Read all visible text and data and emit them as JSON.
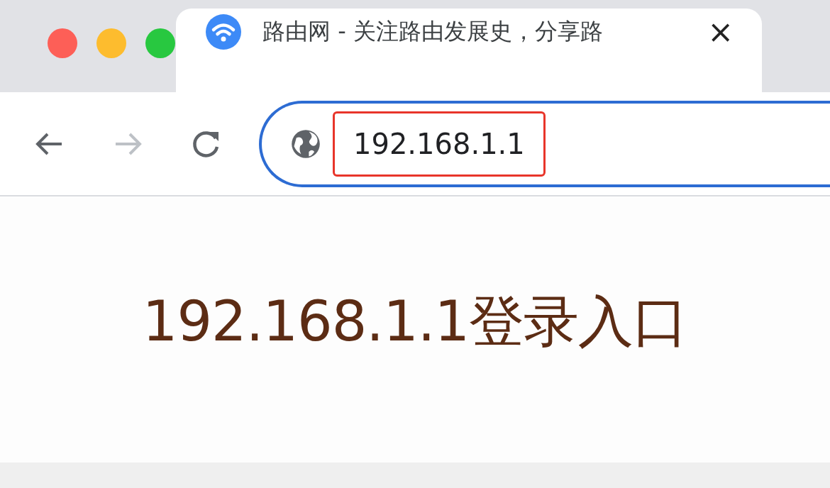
{
  "tab": {
    "title": "路由网 - 关注路由发展史，分享路",
    "selected": true,
    "close": "×"
  },
  "toolbar": {
    "buttons": [
      {
        "kind": "back",
        "disabled": false
      },
      {
        "kind": "forward",
        "disabled": true
      },
      {
        "kind": "reload",
        "disabled": false
      }
    ]
  },
  "address_bar": {
    "value": "192.168.1.1",
    "highlighted": true
  },
  "page": {
    "heading": "192.168.1.1登录入口"
  }
}
